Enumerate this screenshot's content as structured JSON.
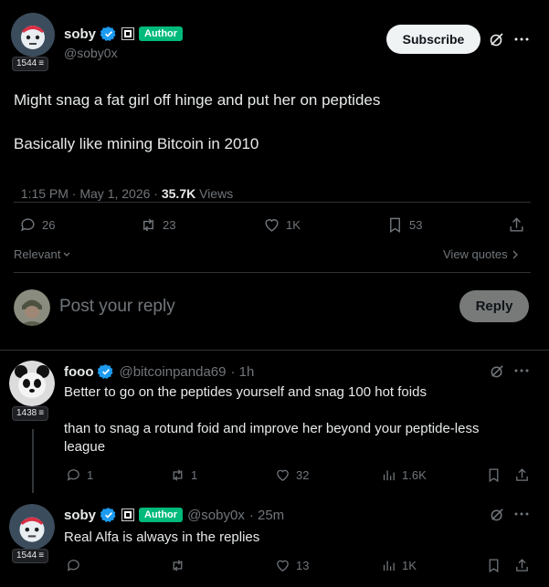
{
  "main_post": {
    "author": {
      "name": "soby",
      "handle": "@soby0x",
      "badge": "Author",
      "avatar_count": "1544"
    },
    "subscribe_label": "Subscribe",
    "text_line1": "Might snag a fat girl off hinge and put her on peptides",
    "text_line2": "Basically like mining Bitcoin in 2010",
    "meta_time": "1:15 PM · May 1, 2026 · ",
    "views_count": "35.7K",
    "views_label": " Views",
    "stats": {
      "replies": "26",
      "reposts": "23",
      "likes": "1K",
      "bookmarks": "53"
    },
    "sort_label": "Relevant",
    "view_quotes_label": "View quotes"
  },
  "composer": {
    "placeholder": "Post your reply",
    "reply_label": "Reply"
  },
  "replies": [
    {
      "name": "fooo",
      "handle": "@bitcoinpanda69",
      "time": "· 1h",
      "avatar_count": "1438",
      "text_line1": "Better to go on the peptides yourself and snag 100 hot foids",
      "text_line2": "than to snag a rotund foid and improve her beyond your peptide-less",
      "text_line3": "league",
      "stats": {
        "replies": "1",
        "reposts": "1",
        "likes": "32",
        "views": "1.6K"
      }
    },
    {
      "name": "soby",
      "badge": "Author",
      "handle": "@soby0x",
      "time": "· 25m",
      "avatar_count": "1544",
      "text": "Real Alfa is always in the replies",
      "stats": {
        "likes": "13",
        "views": "1K"
      }
    }
  ],
  "colors": {
    "background": "#000000",
    "verified": "#1d9bf0",
    "author_badge": "#00ba7c",
    "muted": "#71767b"
  }
}
